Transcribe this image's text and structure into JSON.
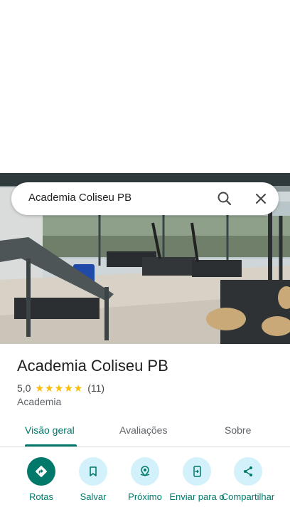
{
  "search": {
    "query": "Academia Coliseu PB"
  },
  "place": {
    "name": "Academia Coliseu PB",
    "rating": "5,0",
    "stars": "★★★★★",
    "review_count": "(11)",
    "category": "Academia"
  },
  "tabs": [
    {
      "label": "Visão geral",
      "active": true
    },
    {
      "label": "Avaliações",
      "active": false
    },
    {
      "label": "Sobre",
      "active": false
    }
  ],
  "actions": [
    {
      "label": "Rotas",
      "icon": "directions-icon"
    },
    {
      "label": "Salvar",
      "icon": "bookmark-icon"
    },
    {
      "label": "Próximo",
      "icon": "nearby-icon"
    },
    {
      "label": "Enviar para o",
      "icon": "send-to-phone-icon"
    },
    {
      "label": "Compartilhar",
      "icon": "share-icon"
    }
  ],
  "colors": {
    "accent": "#00796b",
    "star": "#fbbc04",
    "action_bg": "#d3f1fa"
  }
}
